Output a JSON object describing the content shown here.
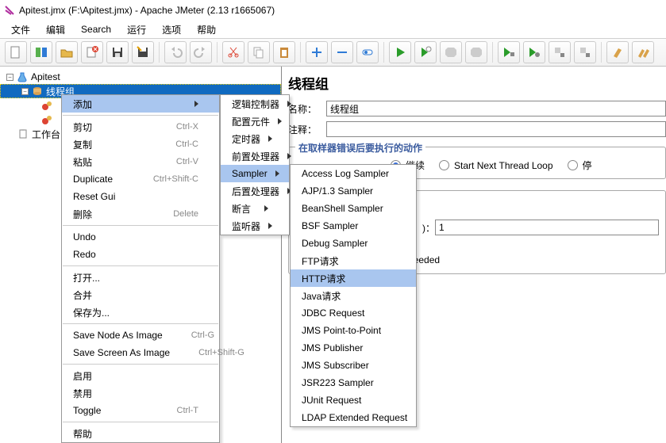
{
  "title": "Apitest.jmx (F:\\Apitest.jmx) - Apache JMeter (2.13 r1665067)",
  "menubar": [
    "文件",
    "编辑",
    "Search",
    "运行",
    "选项",
    "帮助"
  ],
  "tree": {
    "items": [
      {
        "level": 0,
        "expand": "minus",
        "icon": "flask",
        "label": "Apitest"
      },
      {
        "level": 1,
        "expand": "minus",
        "icon": "spool",
        "label": "线程组",
        "selected": true
      },
      {
        "level": 2,
        "expand": "none",
        "icon": "gear-red",
        "label": ""
      },
      {
        "level": 2,
        "expand": "none",
        "icon": "gear-red",
        "label": ""
      },
      {
        "level": 0,
        "expand": "none",
        "icon": "clipboard",
        "label": "工作台"
      }
    ]
  },
  "content": {
    "title": "线程组",
    "name_label": "名称：",
    "name_value": "线程组",
    "comment_label": "注释：",
    "panel_title": "在取样器错误后要执行的动作",
    "radio_continue": "继续",
    "radio_startnext": "Start Next Thread Loop",
    "radio_stop": "停",
    "field1_input": "1",
    "field_needed": "til needed"
  },
  "ctx1": [
    {
      "t": "item",
      "label": "添加",
      "hi": true,
      "arrow": true
    },
    {
      "t": "sep"
    },
    {
      "t": "item",
      "label": "剪切",
      "accel": "Ctrl-X"
    },
    {
      "t": "item",
      "label": "复制",
      "accel": "Ctrl-C"
    },
    {
      "t": "item",
      "label": "粘贴",
      "accel": "Ctrl-V"
    },
    {
      "t": "item",
      "label": "Duplicate",
      "accel": "Ctrl+Shift-C"
    },
    {
      "t": "item",
      "label": "Reset Gui"
    },
    {
      "t": "item",
      "label": "删除",
      "accel": "Delete"
    },
    {
      "t": "sep"
    },
    {
      "t": "item",
      "label": "Undo"
    },
    {
      "t": "item",
      "label": "Redo"
    },
    {
      "t": "sep"
    },
    {
      "t": "item",
      "label": "打开..."
    },
    {
      "t": "item",
      "label": "合并"
    },
    {
      "t": "item",
      "label": "保存为..."
    },
    {
      "t": "sep"
    },
    {
      "t": "item",
      "label": "Save Node As Image",
      "accel": "Ctrl-G"
    },
    {
      "t": "item",
      "label": "Save Screen As Image",
      "accel": "Ctrl+Shift-G"
    },
    {
      "t": "sep"
    },
    {
      "t": "item",
      "label": "启用"
    },
    {
      "t": "item",
      "label": "禁用"
    },
    {
      "t": "item",
      "label": "Toggle",
      "accel": "Ctrl-T"
    },
    {
      "t": "sep"
    },
    {
      "t": "item",
      "label": "帮助"
    }
  ],
  "ctx2": [
    {
      "t": "item",
      "label": "逻辑控制器",
      "arrow": true
    },
    {
      "t": "item",
      "label": "配置元件",
      "arrow": true
    },
    {
      "t": "item",
      "label": "定时器",
      "arrow": true
    },
    {
      "t": "item",
      "label": "前置处理器",
      "arrow": true
    },
    {
      "t": "item",
      "label": "Sampler",
      "arrow": true,
      "hi": true
    },
    {
      "t": "item",
      "label": "后置处理器",
      "arrow": true
    },
    {
      "t": "item",
      "label": "断言",
      "arrow": true
    },
    {
      "t": "item",
      "label": "监听器",
      "arrow": true
    }
  ],
  "ctx3": [
    {
      "t": "item",
      "label": "Access Log Sampler"
    },
    {
      "t": "item",
      "label": "AJP/1.3 Sampler"
    },
    {
      "t": "item",
      "label": "BeanShell Sampler"
    },
    {
      "t": "item",
      "label": "BSF Sampler"
    },
    {
      "t": "item",
      "label": "Debug Sampler"
    },
    {
      "t": "item",
      "label": "FTP请求"
    },
    {
      "t": "item",
      "label": "HTTP请求",
      "hi": true
    },
    {
      "t": "item",
      "label": "Java请求"
    },
    {
      "t": "item",
      "label": "JDBC Request"
    },
    {
      "t": "item",
      "label": "JMS Point-to-Point"
    },
    {
      "t": "item",
      "label": "JMS Publisher"
    },
    {
      "t": "item",
      "label": "JMS Subscriber"
    },
    {
      "t": "item",
      "label": "JSR223 Sampler"
    },
    {
      "t": "item",
      "label": "JUnit Request"
    },
    {
      "t": "item",
      "label": "LDAP Extended Request"
    }
  ]
}
